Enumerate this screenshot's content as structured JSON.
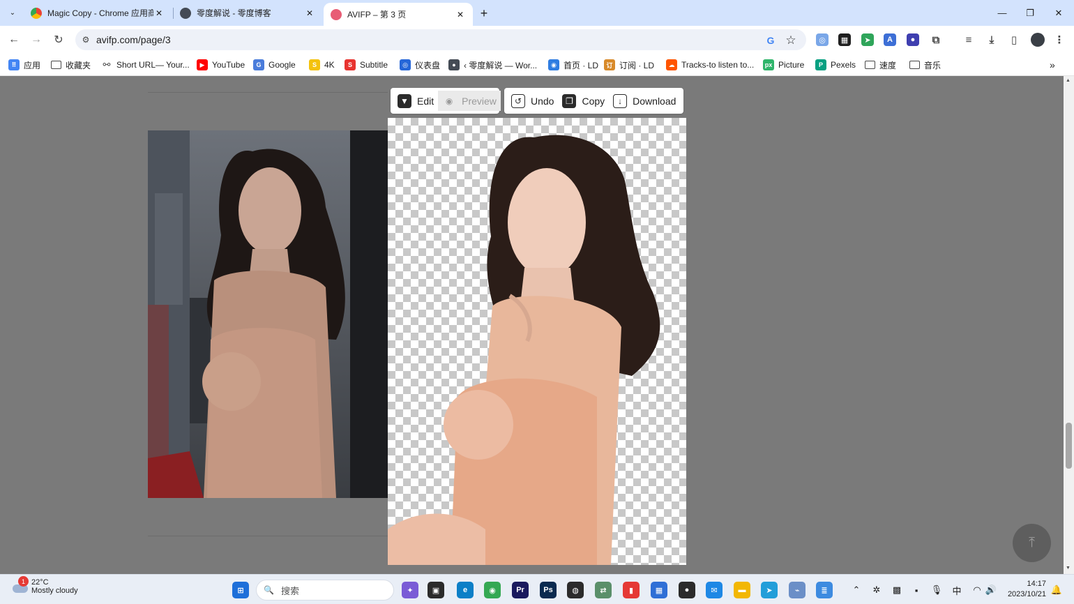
{
  "tabs": [
    {
      "title": "Magic Copy - Chrome 应用商店",
      "favicon_color": "#f4b400"
    },
    {
      "title": "零度解说 - 零度博客",
      "favicon_color": "#444b55"
    },
    {
      "title": "AVIFP – 第 3 页",
      "favicon_color": "#e85d75",
      "active": true
    }
  ],
  "tab_icons": {
    "list": "chevron-down-icon",
    "close": "close-icon",
    "new": "plus-icon"
  },
  "tab_glyphs": {
    "list": "⌄",
    "close": "✕",
    "new": "+"
  },
  "window": {
    "minimize": "—",
    "restore": "❐",
    "close": "✕"
  },
  "nav": {
    "back": "←",
    "forward": "→",
    "reload": "↻"
  },
  "omnibox": {
    "url": "avifp.com/page/3",
    "tune_glyph": "⚙",
    "google_glyph": "G",
    "star_glyph": "☆"
  },
  "extensions": [
    {
      "name": "search-ext",
      "color": "#7aa7e8",
      "glyph": "◎"
    },
    {
      "name": "tab-ext",
      "color": "#1f1f1f",
      "glyph": "▦"
    },
    {
      "name": "green-ext",
      "color": "#2fa55a",
      "glyph": "➤"
    },
    {
      "name": "translate-ext",
      "color": "#3d6fd6",
      "glyph": "A"
    },
    {
      "name": "purple-ext",
      "color": "#3f3fb0",
      "glyph": "●"
    },
    {
      "name": "puzzle-ext",
      "color": "#ffffff",
      "glyph": "⧉"
    },
    {
      "name": "media-ext",
      "color": "#ffffff",
      "glyph": "≡"
    },
    {
      "name": "download-ext",
      "color": "#ffffff",
      "glyph": "⤓"
    },
    {
      "name": "sidepanel-ext",
      "color": "#ffffff",
      "glyph": "▯"
    },
    {
      "name": "menu-ext",
      "color": "#ffffff",
      "glyph": "⋮"
    }
  ],
  "bookmarks": [
    {
      "label": "应用",
      "icon": "apps-icon",
      "color": "#4285f4",
      "glyph": "⠿"
    },
    {
      "label": "收藏夹",
      "icon": "folder-icon",
      "folder": true
    },
    {
      "label": "Short URL— Your...",
      "icon": "link-icon",
      "color": "#ffffff",
      "glyph": "⚯"
    },
    {
      "label": "YouTube",
      "icon": "youtube-icon",
      "color": "#ff0000",
      "glyph": "▶"
    },
    {
      "label": "Google",
      "icon": "google-icon",
      "color": "#4a7cdb",
      "glyph": "G"
    },
    {
      "label": "4K",
      "icon": "4k-icon",
      "color": "#f4c20d",
      "glyph": "S"
    },
    {
      "label": "Subtitle",
      "icon": "subtitle-icon",
      "color": "#e8332f",
      "glyph": "S"
    },
    {
      "label": "仪表盘",
      "icon": "dashboard-icon",
      "color": "#2667d8",
      "glyph": "◎"
    },
    {
      "label": "‹ 零度解说 — Wor...",
      "icon": "avatar-icon",
      "color": "#444b55",
      "glyph": "●"
    },
    {
      "label": "首页 · LD",
      "icon": "home-icon",
      "color": "#2f7de1",
      "glyph": "◉"
    },
    {
      "label": "订阅 · LD",
      "icon": "subscribe-icon",
      "color": "#d88a2a",
      "glyph": "订"
    },
    {
      "label": "Tracks-to listen to...",
      "icon": "soundcloud-icon",
      "color": "#ff5500",
      "glyph": "☁"
    },
    {
      "label": "Picture",
      "icon": "px-icon",
      "color": "#2fb56b",
      "glyph": "px"
    },
    {
      "label": "Pexels",
      "icon": "pexels-icon",
      "color": "#06a081",
      "glyph": "P"
    },
    {
      "label": "速度",
      "icon": "folder-icon",
      "folder": true
    },
    {
      "label": "音乐",
      "icon": "folder-icon",
      "folder": true
    }
  ],
  "bookmarks_more": "»",
  "editor": {
    "edit_label": "Edit",
    "preview_label": "Preview",
    "undo_label": "Undo",
    "copy_label": "Copy",
    "download_label": "Download",
    "edit_glyph": "▼",
    "preview_glyph": "◉",
    "undo_glyph": "↺",
    "copy_glyph": "❐",
    "download_glyph": "↓"
  },
  "back_to_top_glyph": "⤒",
  "scrollbar": {
    "up": "▲",
    "down": "▼",
    "position": 0.73
  },
  "taskbar": {
    "weather": {
      "temp": "22°C",
      "desc": "Mostly cloudy",
      "badge": "1"
    },
    "search_placeholder": "搜索",
    "search_glyph": "🔍",
    "apps": [
      {
        "name": "start-icon",
        "color": "#1e6fd9",
        "glyph": "⊞"
      },
      {
        "name": "copilot-icon",
        "color": "#7a5cd6",
        "glyph": "✦"
      },
      {
        "name": "taskview-icon",
        "color": "#2b2b2b",
        "glyph": "▣"
      },
      {
        "name": "edge-icon",
        "color": "#0c7fc7",
        "glyph": "e"
      },
      {
        "name": "chrome-icon",
        "color": "#34a853",
        "glyph": "◉"
      },
      {
        "name": "premiere-icon",
        "color": "#1a1a5e",
        "glyph": "Pr"
      },
      {
        "name": "photoshop-icon",
        "color": "#0a2a4f",
        "glyph": "Ps"
      },
      {
        "name": "obs-icon",
        "color": "#2b2b2b",
        "glyph": "◍"
      },
      {
        "name": "transfer-icon",
        "color": "#5a8f6a",
        "glyph": "⇄"
      },
      {
        "name": "red-app-icon",
        "color": "#e53935",
        "glyph": "▮"
      },
      {
        "name": "calendar-icon",
        "color": "#2f6fd6",
        "glyph": "▦"
      },
      {
        "name": "media-icon",
        "color": "#2b2b2b",
        "glyph": "●"
      },
      {
        "name": "mail-icon",
        "color": "#1e88e5",
        "glyph": "✉"
      },
      {
        "name": "explorer-icon",
        "color": "#f2b705",
        "glyph": "▬"
      },
      {
        "name": "telegram-icon",
        "color": "#229ed9",
        "glyph": "➤"
      },
      {
        "name": "monitor-icon",
        "color": "#6b8fc7",
        "glyph": "⌁"
      },
      {
        "name": "notepad-icon",
        "color": "#3d8be0",
        "glyph": "≣"
      }
    ],
    "tray": [
      {
        "name": "chevron-up-icon",
        "glyph": "⌃"
      },
      {
        "name": "network-app-icon",
        "glyph": "✲"
      },
      {
        "name": "color-app-icon",
        "glyph": "▩"
      },
      {
        "name": "gray-app-icon",
        "glyph": "▪"
      },
      {
        "name": "mic-icon",
        "glyph": "🎙"
      },
      {
        "name": "ime-icon",
        "glyph": "中"
      },
      {
        "name": "wifi-icon",
        "glyph": "◠"
      },
      {
        "name": "volume-icon",
        "glyph": "🔊"
      }
    ],
    "time": "14:17",
    "date": "2023/10/21",
    "notification_glyph": "🔔"
  }
}
